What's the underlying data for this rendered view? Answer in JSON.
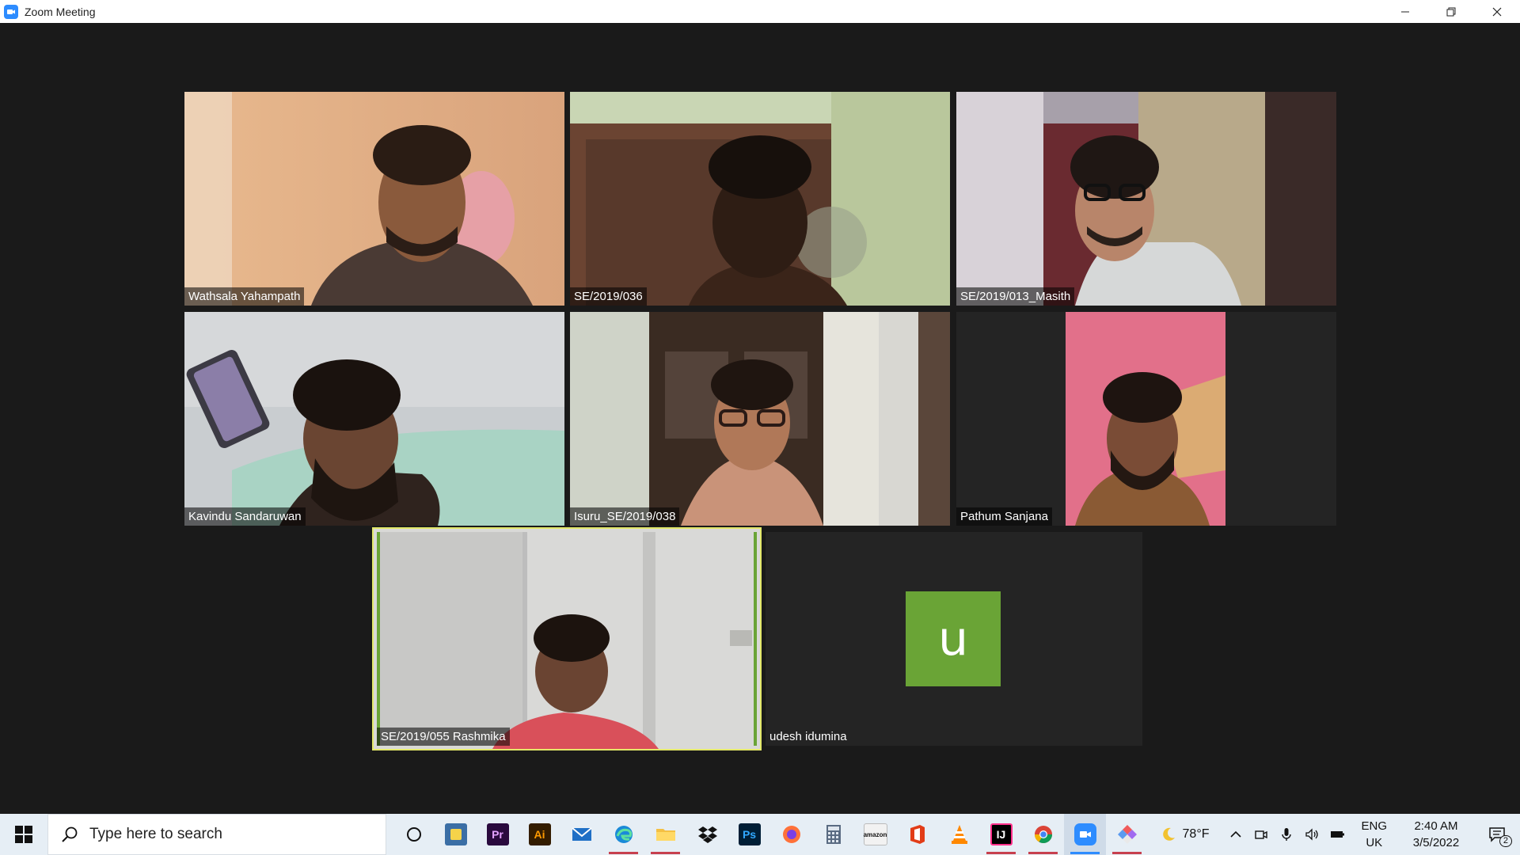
{
  "window": {
    "title": "Zoom Meeting"
  },
  "participants": [
    {
      "name": "Wathsala Yahampath",
      "video": "on"
    },
    {
      "name": "SE/2019/036",
      "video": "on"
    },
    {
      "name": "SE/2019/013_Masith",
      "video": "on"
    },
    {
      "name": "Kavindu Sandaruwan",
      "video": "on"
    },
    {
      "name": "Isuru_SE/2019/038",
      "video": "on"
    },
    {
      "name": "Pathum Sanjana",
      "video": "on"
    },
    {
      "name": "SE/2019/055 Rashmika",
      "video": "on",
      "active_speaker": true
    },
    {
      "name": "udesh idumina",
      "video": "off",
      "avatar_letter": "u"
    }
  ],
  "colors": {
    "active_speaker_border": "#e3e86a",
    "avatar_bg": "#6aa436",
    "taskbar_bg": "#e6eef5"
  },
  "taskbar": {
    "search_placeholder": "Type here to search",
    "apps": [
      {
        "name": "task-view",
        "label": ""
      },
      {
        "name": "python-idle",
        "label": ""
      },
      {
        "name": "premiere-pro",
        "label": "Pr"
      },
      {
        "name": "illustrator",
        "label": "Ai"
      },
      {
        "name": "mail",
        "label": ""
      },
      {
        "name": "edge",
        "label": ""
      },
      {
        "name": "file-explorer",
        "label": ""
      },
      {
        "name": "dropbox",
        "label": ""
      },
      {
        "name": "photoshop",
        "label": "Ps"
      },
      {
        "name": "firefox",
        "label": ""
      },
      {
        "name": "calculator",
        "label": ""
      },
      {
        "name": "amazon",
        "label": "amazon"
      },
      {
        "name": "office",
        "label": ""
      },
      {
        "name": "vlc",
        "label": ""
      },
      {
        "name": "intellij",
        "label": "IJ"
      },
      {
        "name": "chrome",
        "label": ""
      },
      {
        "name": "zoom",
        "label": ""
      },
      {
        "name": "git-kraken",
        "label": ""
      }
    ],
    "weather": {
      "temp": "78°F",
      "icon": "moon-icon"
    },
    "language": {
      "top": "ENG",
      "bottom": "UK"
    },
    "clock": {
      "time": "2:40 AM",
      "date": "3/5/2022"
    },
    "notifications": "2"
  }
}
